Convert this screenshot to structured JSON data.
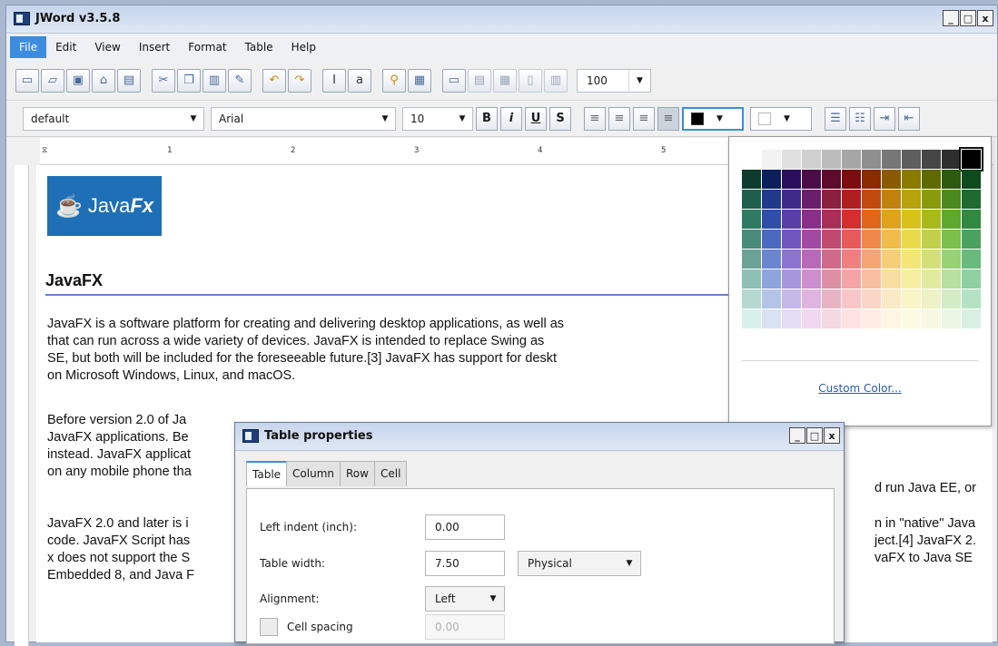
{
  "app": {
    "title": "JWord v3.5.8"
  },
  "window_buttons": {
    "minimize": "_",
    "maximize": "□",
    "close": "x"
  },
  "menu": [
    "File",
    "Edit",
    "View",
    "Insert",
    "Format",
    "Table",
    "Help"
  ],
  "toolbar": {
    "zoom_value": "100",
    "icons": [
      "new-document-icon",
      "open-folder-icon",
      "save-icon",
      "save-as-icon",
      "print-preview-icon",
      "cut-icon",
      "copy-icon",
      "paste-icon",
      "format-painter-icon",
      "undo-icon",
      "redo-icon",
      "insert-text-icon",
      "spellcheck-icon",
      "insert-link-icon",
      "insert-image-icon",
      "insert-table-icon",
      "table-row-icon",
      "table-merge-icon",
      "table-column-icon",
      "table-split-icon"
    ]
  },
  "format_bar": {
    "style": "default",
    "font": "Arial",
    "size": "10",
    "bold": "B",
    "italic": "i",
    "underline": "U",
    "strike": "S",
    "text_color": "#000000",
    "highlight_color": "#ffffff"
  },
  "ruler": {
    "numbers": [
      "1",
      "2",
      "3",
      "4",
      "5"
    ]
  },
  "document": {
    "logo_text": "Java",
    "logo_text_fx": "Fx",
    "heading": "JavaFX",
    "paragraphs": [
      "JavaFX is a software platform for creating and delivering desktop applications, as well as\nthat can run across a wide variety of devices. JavaFX is intended to replace Swing as\nSE, but both will be included for the foreseeable future.[3] JavaFX has support for deskt\non Microsoft Windows, Linux, and macOS.",
      "Before version 2.0 of Ja\nJavaFX applications. Be\ninstead. JavaFX applicat\non any mobile phone tha",
      "JavaFX 2.0 and later is i\ncode. JavaFX Script has\nx does not support the S\nEmbedded 8, and Java F"
    ],
    "right_fragments": [
      "d run Java EE, or",
      "n in \"native\" Java\nject.[4] JavaFX 2.\nvaFX to Java SE"
    ]
  },
  "color_popup": {
    "custom_label": "Custom Color...",
    "selected": "#000000",
    "palette": [
      [
        "#ffffff",
        "#f2f2f2",
        "#e0e0e0",
        "#cfcfcf",
        "#bcbcbc",
        "#a6a6a6",
        "#8f8f8f",
        "#777777",
        "#5e5e5e",
        "#464646",
        "#2e2e2e",
        "#000000"
      ],
      [
        "#0d3b2e",
        "#0a1f5c",
        "#2a0f5e",
        "#4b0d4a",
        "#5e0a2a",
        "#7a0d0d",
        "#8a2a00",
        "#8a5a00",
        "#8a7a00",
        "#5e6a00",
        "#2e5a0d",
        "#0d4a1e"
      ],
      [
        "#1f5e4a",
        "#1f3a8a",
        "#3f2a8a",
        "#6a1f6a",
        "#8a1f3f",
        "#b01f1f",
        "#c04a0d",
        "#c0820d",
        "#b8a20d",
        "#8a9a0d",
        "#4a8a1f",
        "#1f6a2e"
      ],
      [
        "#2e7a62",
        "#2e4ea8",
        "#5a3ea8",
        "#8a2e8a",
        "#a82e55",
        "#d42e2e",
        "#e0661a",
        "#e0a21a",
        "#d8c21a",
        "#a8ba1a",
        "#5ea82e",
        "#2e8a40"
      ],
      [
        "#4a8a7a",
        "#4a6ac0",
        "#7256c0",
        "#a24aa2",
        "#c04a6e",
        "#e85a5a",
        "#f0884a",
        "#f0bc4a",
        "#eada4a",
        "#c0d04a",
        "#7ac04a",
        "#4aa25e"
      ],
      [
        "#6aa296",
        "#6a86d0",
        "#8c74d0",
        "#b86ab8",
        "#d06a88",
        "#f08080",
        "#f5a476",
        "#f5cf76",
        "#f2e676",
        "#d4e076",
        "#98d276",
        "#6aba7e"
      ],
      [
        "#8ec0b6",
        "#8ea4dc",
        "#a896dc",
        "#cc8ecc",
        "#dc8ea4",
        "#f5a4a4",
        "#f8bea0",
        "#f8dea0",
        "#f6eea0",
        "#e2eaa0",
        "#b8e0a0",
        "#8ed0a0"
      ],
      [
        "#b4d8d0",
        "#b4c4e8",
        "#c6b8e8",
        "#e0b4e0",
        "#e8b4c4",
        "#f8c6c6",
        "#fad6c6",
        "#faeac6",
        "#f8f4c6",
        "#eef2c6",
        "#d4ecc6",
        "#b4e2c4"
      ],
      [
        "#d8f0ec",
        "#d8e2f4",
        "#e4dcf4",
        "#f0d8f0",
        "#f4d8e2",
        "#fde2e2",
        "#feece2",
        "#fef6e2",
        "#fcfae2",
        "#f6f8e2",
        "#eaf6e2",
        "#d8f0e2"
      ]
    ]
  },
  "table_dialog": {
    "title": "Table properties",
    "tabs": [
      "Table",
      "Column",
      "Row",
      "Cell"
    ],
    "left_indent_label": "Left indent (inch):",
    "left_indent_value": "0.00",
    "table_width_label": "Table width:",
    "table_width_value": "7.50",
    "width_type": "Physical",
    "alignment_label": "Alignment:",
    "alignment_value": "Left",
    "cell_spacing_label": "Cell spacing",
    "cell_spacing_value": "0.00"
  }
}
